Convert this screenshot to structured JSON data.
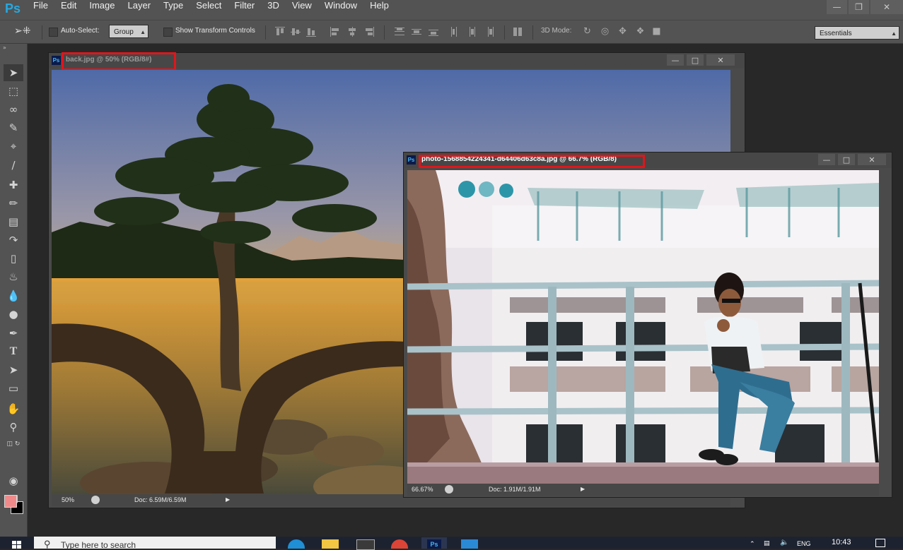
{
  "app": {
    "logo": "Ps"
  },
  "menu": [
    "File",
    "Edit",
    "Image",
    "Layer",
    "Type",
    "Select",
    "Filter",
    "3D",
    "View",
    "Window",
    "Help"
  ],
  "options_bar": {
    "auto_select_label": "Auto-Select:",
    "auto_select_value": "Group",
    "show_transform_label": "Show Transform Controls",
    "mode_label": "3D Mode:",
    "workspace": "Essentials"
  },
  "doc1": {
    "title": "back.jpg @ 50% (RGB/8#)",
    "zoom": "50%",
    "doc_size": "Doc: 6.59M/6.59M"
  },
  "doc2": {
    "title": "photo-1568854224341-d64406d63c8a.jpg @ 66.7% (RGB/8)",
    "zoom": "66.67%",
    "doc_size": "Doc: 1.91M/1.91M"
  },
  "taskbar": {
    "search_placeholder": "Type here to search",
    "time": "10:43",
    "lang": "ENG"
  },
  "colors": {
    "foreground": "#f08a8a",
    "background": "#000000",
    "highlight": "#e0161b"
  }
}
